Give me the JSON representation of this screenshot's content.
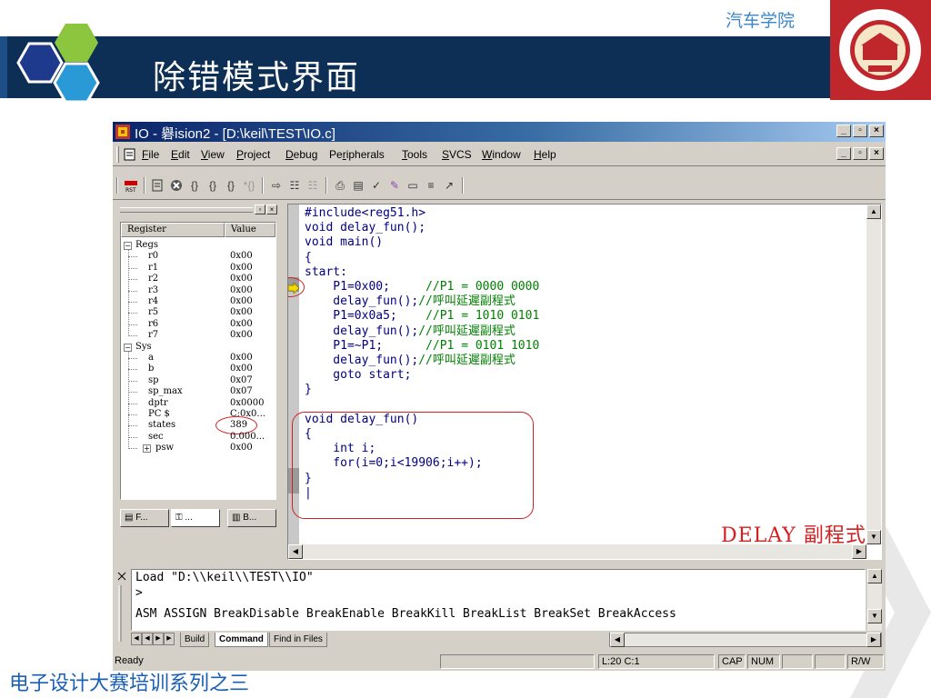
{
  "slide": {
    "title": "除错模式界面",
    "college": "汽车学院",
    "footer": "电子设计大赛培训系列之三",
    "colors": {
      "header_bg": "#0e2f55",
      "accent_blue": "#3a86c8",
      "seal_red": "#c0272d",
      "annotation_red": "#d42020"
    }
  },
  "window": {
    "title": "IO  - 礜ision2 - [D:\\keil\\TEST\\IO.c]",
    "controls": [
      "_",
      "▫",
      "×"
    ]
  },
  "menu": {
    "items": [
      {
        "label": "File",
        "key": "F"
      },
      {
        "label": "Edit",
        "key": "E"
      },
      {
        "label": "View",
        "key": "V"
      },
      {
        "label": "Project",
        "key": "P"
      },
      {
        "label": "Debug",
        "key": "D"
      },
      {
        "label": "Peripherals",
        "key": "r"
      },
      {
        "label": "Tools",
        "key": "T"
      },
      {
        "label": "SVCS",
        "key": "S"
      },
      {
        "label": "Window",
        "key": "W"
      },
      {
        "label": "Help",
        "key": "H"
      }
    ]
  },
  "toolbar": {
    "icons": [
      "reset-cpu-icon",
      "run-icon",
      "stop-icon",
      "step-into-icon",
      "step-over-icon",
      "step-out-icon",
      "run-to-cursor-icon",
      "show-next-statement-icon",
      "enable-trace-icon",
      "view-trace-icon",
      "disassembly-window-icon",
      "watch-window-icon",
      "code-coverage-icon",
      "serial-window-icon",
      "memory-window-icon",
      "performance-analyzer-icon",
      "tool-icon"
    ]
  },
  "registers": {
    "col_register": "Register",
    "col_value": "Value",
    "groups": [
      {
        "name": "Regs",
        "rows": [
          {
            "name": "r0",
            "value": "0x00"
          },
          {
            "name": "r1",
            "value": "0x00"
          },
          {
            "name": "r2",
            "value": "0x00"
          },
          {
            "name": "r3",
            "value": "0x00"
          },
          {
            "name": "r4",
            "value": "0x00"
          },
          {
            "name": "r5",
            "value": "0x00"
          },
          {
            "name": "r6",
            "value": "0x00"
          },
          {
            "name": "r7",
            "value": "0x00"
          }
        ]
      },
      {
        "name": "Sys",
        "rows": [
          {
            "name": "a",
            "value": "0x00"
          },
          {
            "name": "b",
            "value": "0x00"
          },
          {
            "name": "sp",
            "value": "0x07"
          },
          {
            "name": "sp_max",
            "value": "0x07"
          },
          {
            "name": "dptr",
            "value": "0x0000"
          },
          {
            "name": "PC  $",
            "value": "C:0x0..."
          },
          {
            "name": "states",
            "value": "389"
          },
          {
            "name": "sec",
            "value": "0.000..."
          },
          {
            "name": "psw",
            "value": "0x00"
          }
        ]
      }
    ],
    "tabs": [
      "F...",
      "...",
      "B..."
    ]
  },
  "code": {
    "lines": [
      {
        "text": "#include<reg51.h>",
        "comment": ""
      },
      {
        "text": "void delay_fun();",
        "comment": ""
      },
      {
        "text": "void main()",
        "comment": ""
      },
      {
        "text": "{",
        "comment": ""
      },
      {
        "text": "start:",
        "comment": ""
      },
      {
        "text": "    P1=0x00;     ",
        "comment": "//P1 = 0000 0000"
      },
      {
        "text": "    delay_fun();",
        "comment": "//呼叫延遲副程式"
      },
      {
        "text": "    P1=0x0a5;    ",
        "comment": "//P1 = 1010 0101"
      },
      {
        "text": "    delay_fun();",
        "comment": "//呼叫延遲副程式"
      },
      {
        "text": "    P1=~P1;      ",
        "comment": "//P1 = 0101 1010"
      },
      {
        "text": "    delay_fun();",
        "comment": "//呼叫延遲副程式"
      },
      {
        "text": "    goto start;",
        "comment": ""
      },
      {
        "text": "}",
        "comment": ""
      },
      {
        "text": "",
        "comment": ""
      },
      {
        "text": "void delay_fun()",
        "comment": ""
      },
      {
        "text": "{",
        "comment": ""
      },
      {
        "text": "    int i;",
        "comment": ""
      },
      {
        "text": "    for(i=0;i<19906;i++);",
        "comment": ""
      },
      {
        "text": "}",
        "comment": ""
      },
      {
        "text": "|",
        "comment": ""
      }
    ],
    "annotation": "DELAY  副程式"
  },
  "output": {
    "lines": [
      "Load \"D:\\\\keil\\\\TEST\\\\IO\"",
      ">",
      "ASM ASSIGN BreakDisable BreakEnable BreakKill BreakList BreakSet BreakAccess"
    ],
    "tabs": [
      "Build",
      "Command",
      "Find in Files"
    ],
    "active_tab": "Command"
  },
  "status": {
    "ready": "Ready",
    "position": "L:20 C:1",
    "cap": "CAP",
    "num": "NUM",
    "rw": "R/W"
  }
}
